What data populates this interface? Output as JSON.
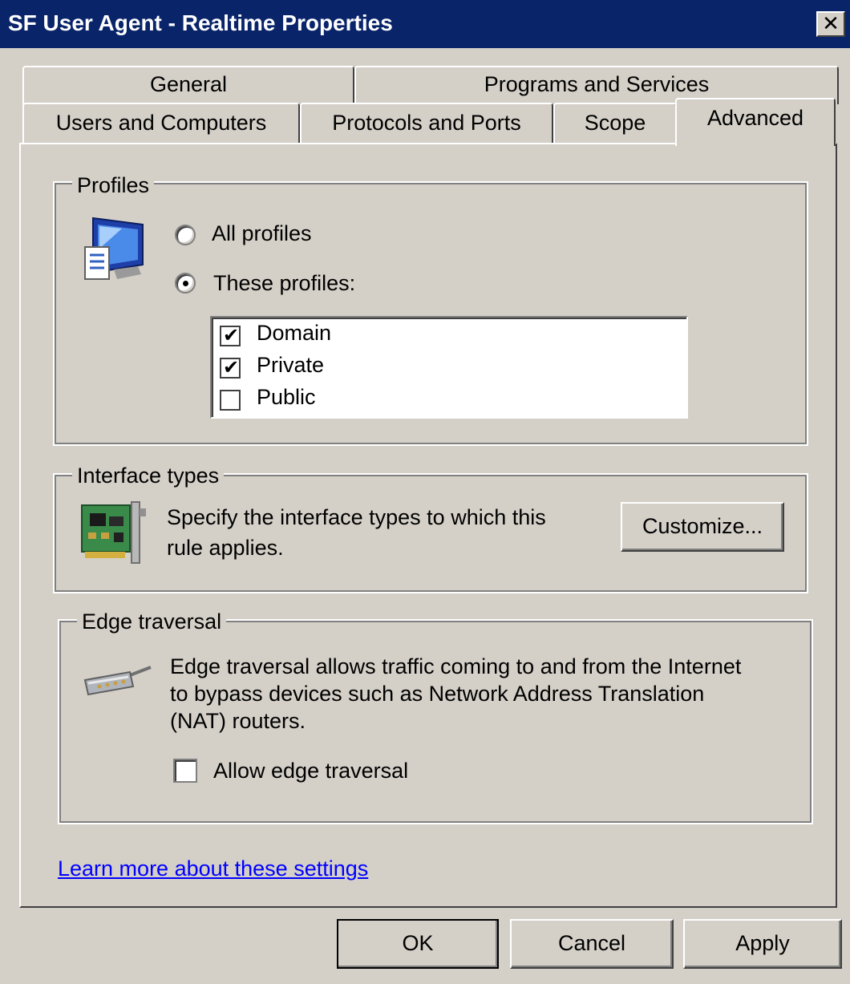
{
  "window": {
    "title": "SF User Agent - Realtime Properties",
    "close_glyph": "✕"
  },
  "tabs": {
    "row1": [
      "General",
      "Programs and Services"
    ],
    "row2": [
      "Users and Computers",
      "Protocols and Ports",
      "Scope",
      "Advanced"
    ],
    "active": "Advanced"
  },
  "profiles": {
    "legend": "Profiles",
    "icon": "monitor-document-icon",
    "radio_all": {
      "label": "All profiles",
      "selected": false
    },
    "radio_these": {
      "label": "These profiles:",
      "selected": true
    },
    "list": [
      {
        "label": "Domain",
        "checked": true
      },
      {
        "label": "Private",
        "checked": true
      },
      {
        "label": "Public",
        "checked": false
      }
    ],
    "check_glyph": "✔"
  },
  "interface_types": {
    "legend": "Interface types",
    "icon": "network-card-icon",
    "desc_line1": "Specify the interface types to which this",
    "desc_line2": "rule applies.",
    "customize_label": "Customize..."
  },
  "edge_traversal": {
    "legend": "Edge traversal",
    "icon": "network-cable-icon",
    "desc_line1": "Edge traversal allows traffic coming to and from the Internet",
    "desc_line2": "to bypass devices such as Network Address Translation",
    "desc_line3": "(NAT) routers.",
    "allow_label": "Allow edge traversal",
    "allow_checked": false
  },
  "learn_more": "Learn more about these settings",
  "buttons": {
    "ok": "OK",
    "cancel": "Cancel",
    "apply": "Apply"
  }
}
